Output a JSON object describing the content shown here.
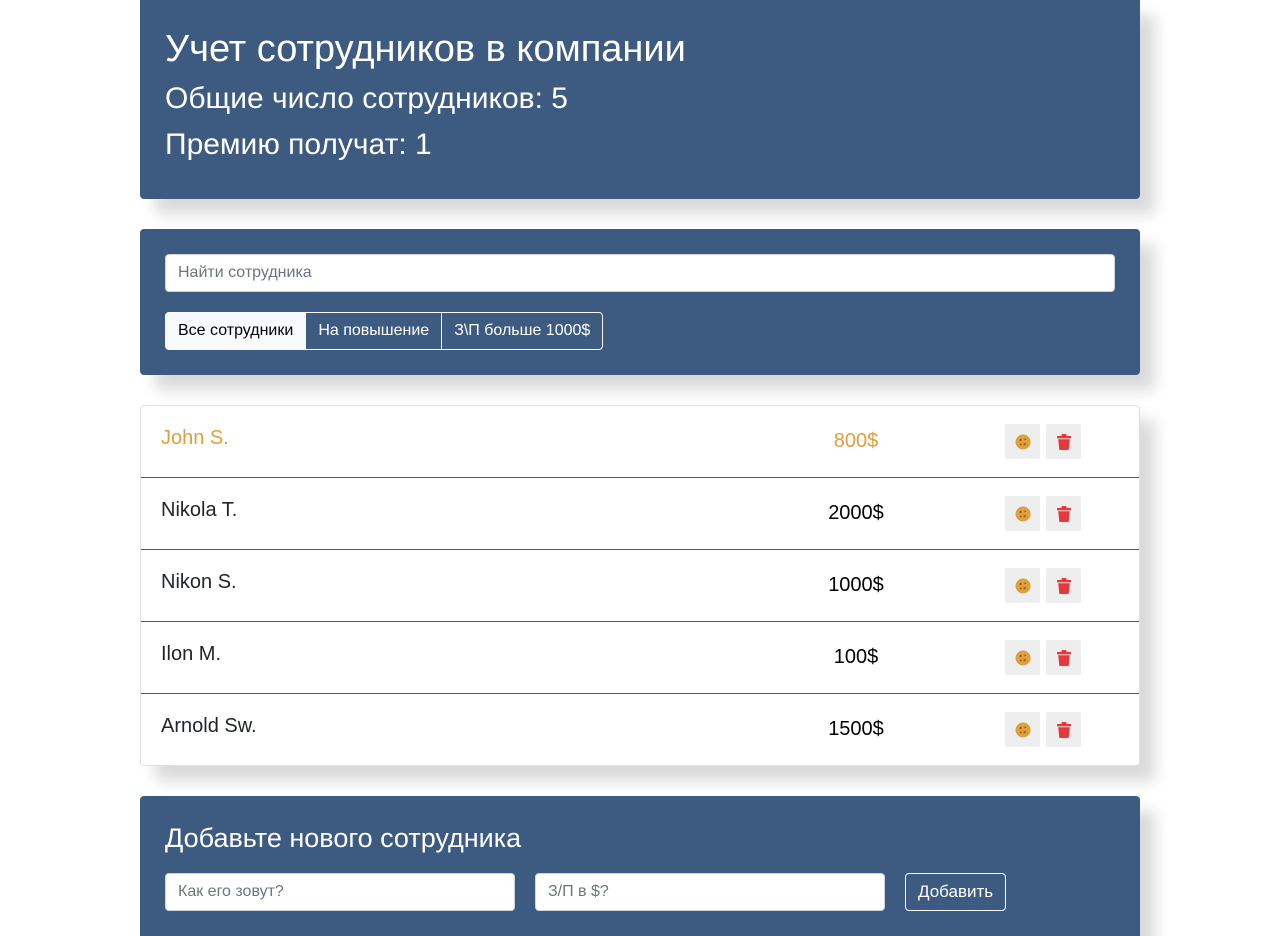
{
  "app_info": {
    "title": "Учет сотрудников в компании",
    "total_label": "Общие число сотрудников: 5",
    "bonus_label": "Премию получат: 1"
  },
  "search": {
    "placeholder": "Найти сотрудника"
  },
  "filters": [
    {
      "label": "Все сотрудники",
      "active": true
    },
    {
      "label": "На повышение",
      "active": false
    },
    {
      "label": "З\\П больше 1000$",
      "active": false
    }
  ],
  "employees": [
    {
      "name": "John S.",
      "salary": "800$",
      "increase": true
    },
    {
      "name": "Nikola T.",
      "salary": "2000$",
      "increase": false
    },
    {
      "name": "Nikon S.",
      "salary": "1000$",
      "increase": false
    },
    {
      "name": "Ilon M.",
      "salary": "100$",
      "increase": false
    },
    {
      "name": "Arnold Sw.",
      "salary": "1500$",
      "increase": false
    }
  ],
  "icons": {
    "cookie": "cookie-icon",
    "trash": "trash-icon"
  },
  "colors": {
    "panel": "#3d5a80",
    "accent": "#e09f3e",
    "danger": "#e5383b",
    "button_bg": "#eeeeee"
  },
  "add_form": {
    "title": "Добавьте нового сотрудника",
    "name_placeholder": "Как его зовут?",
    "salary_placeholder": "З/П в $?",
    "submit_label": "Добавить"
  }
}
